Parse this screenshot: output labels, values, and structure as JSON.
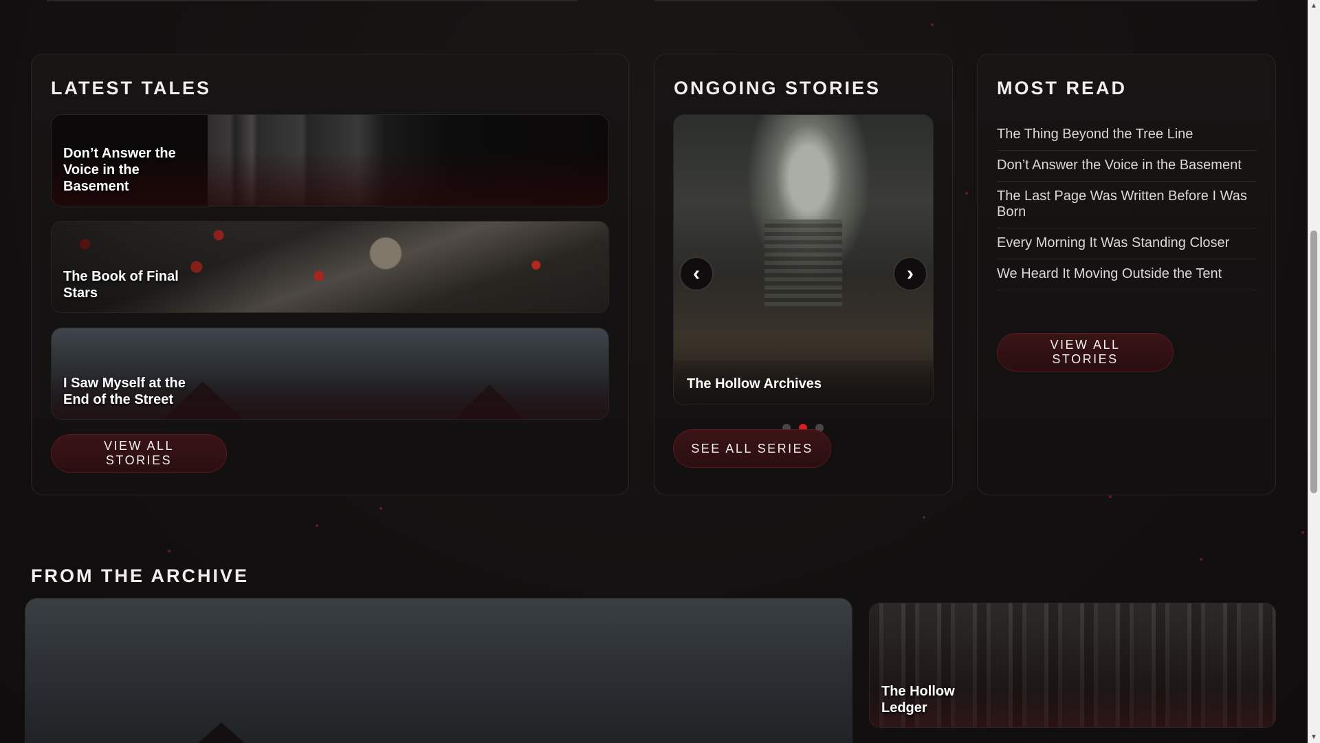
{
  "latest_tales": {
    "heading": "LATEST TALES",
    "cards": [
      {
        "title": "Don’t Answer the Voice in the Basement"
      },
      {
        "title": "The Book of Final Stars"
      },
      {
        "title": "I Saw Myself at the End of the Street"
      }
    ],
    "button_label": "VIEW ALL STORIES"
  },
  "ongoing_stories": {
    "heading": "ONGOING STORIES",
    "slide_caption": "The Hollow Archives",
    "prev_glyph": "‹",
    "next_glyph": "›",
    "slide_count": 3,
    "active_slide": 2,
    "button_label": "SEE ALL SERIES"
  },
  "most_read": {
    "heading": "MOST READ",
    "items": [
      "The Thing Beyond the Tree Line",
      "Don’t Answer the Voice in the Basement",
      "The Last Page Was Written Before I Was Born",
      "Every Morning It Was Standing Closer",
      "We Heard It Moving Outside the Tent"
    ],
    "button_label": "VIEW ALL STORIES"
  },
  "archive": {
    "heading": "FROM THE ARCHIVE",
    "small_card_title": "The Hollow Ledger"
  },
  "colors": {
    "background": "#121010",
    "accent": "#d42222",
    "button_bg": "#2a0e10"
  },
  "scrollbar": {
    "up_glyph": "▲",
    "down_glyph": "▼"
  }
}
